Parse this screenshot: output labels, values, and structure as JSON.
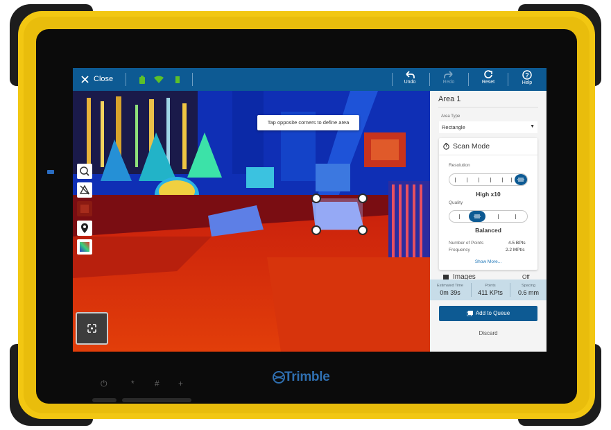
{
  "topbar": {
    "close_label": "Close",
    "undo_label": "Undo",
    "redo_label": "Redo",
    "reset_label": "Reset",
    "help_label": "Help",
    "status_icons": [
      "battery-icon",
      "wifi-icon",
      "device-battery-icon"
    ]
  },
  "camera": {
    "hint": "Tap opposite corners to define area",
    "tools": [
      "magnify-location-icon",
      "no-triangle-icon",
      "layer-icon",
      "location-pin-icon",
      "color-gradient-icon"
    ],
    "minimap_icon": "crosshair-frame-icon"
  },
  "panel": {
    "title": "Area 1",
    "area_type_label": "Area Type",
    "area_type_value": "Rectangle",
    "scan_mode": {
      "title": "Scan Mode",
      "resolution_label": "Resolution",
      "resolution_value": "High x10",
      "resolution_level": 1.0,
      "quality_label": "Quality",
      "quality_value": "Balanced",
      "quality_level": 0.25,
      "points_label": "Number of Points",
      "points_value": "4.5 BPts",
      "frequency_label": "Frequency",
      "frequency_value": "2.2 MPt/s",
      "show_more": "Show More..."
    },
    "images_label": "Images",
    "images_toggle": "Off",
    "stats": {
      "time_label": "Estimated Time",
      "time_value": "0m 39s",
      "points_label": "Points",
      "points_value": "411 KPts",
      "spacing_label": "Spacing",
      "spacing_value": "0.6 mm"
    },
    "add_queue": "Add to Queue",
    "discard": "Discard"
  },
  "device": {
    "brand": "Trimble",
    "hw_buttons": [
      "⏻",
      "*",
      "#",
      "+"
    ]
  },
  "colors": {
    "accent": "#0d5a93",
    "device_yellow": "#f2c712",
    "panel_bg": "#f4f4f4",
    "stats_bg": "#c7dce8"
  }
}
